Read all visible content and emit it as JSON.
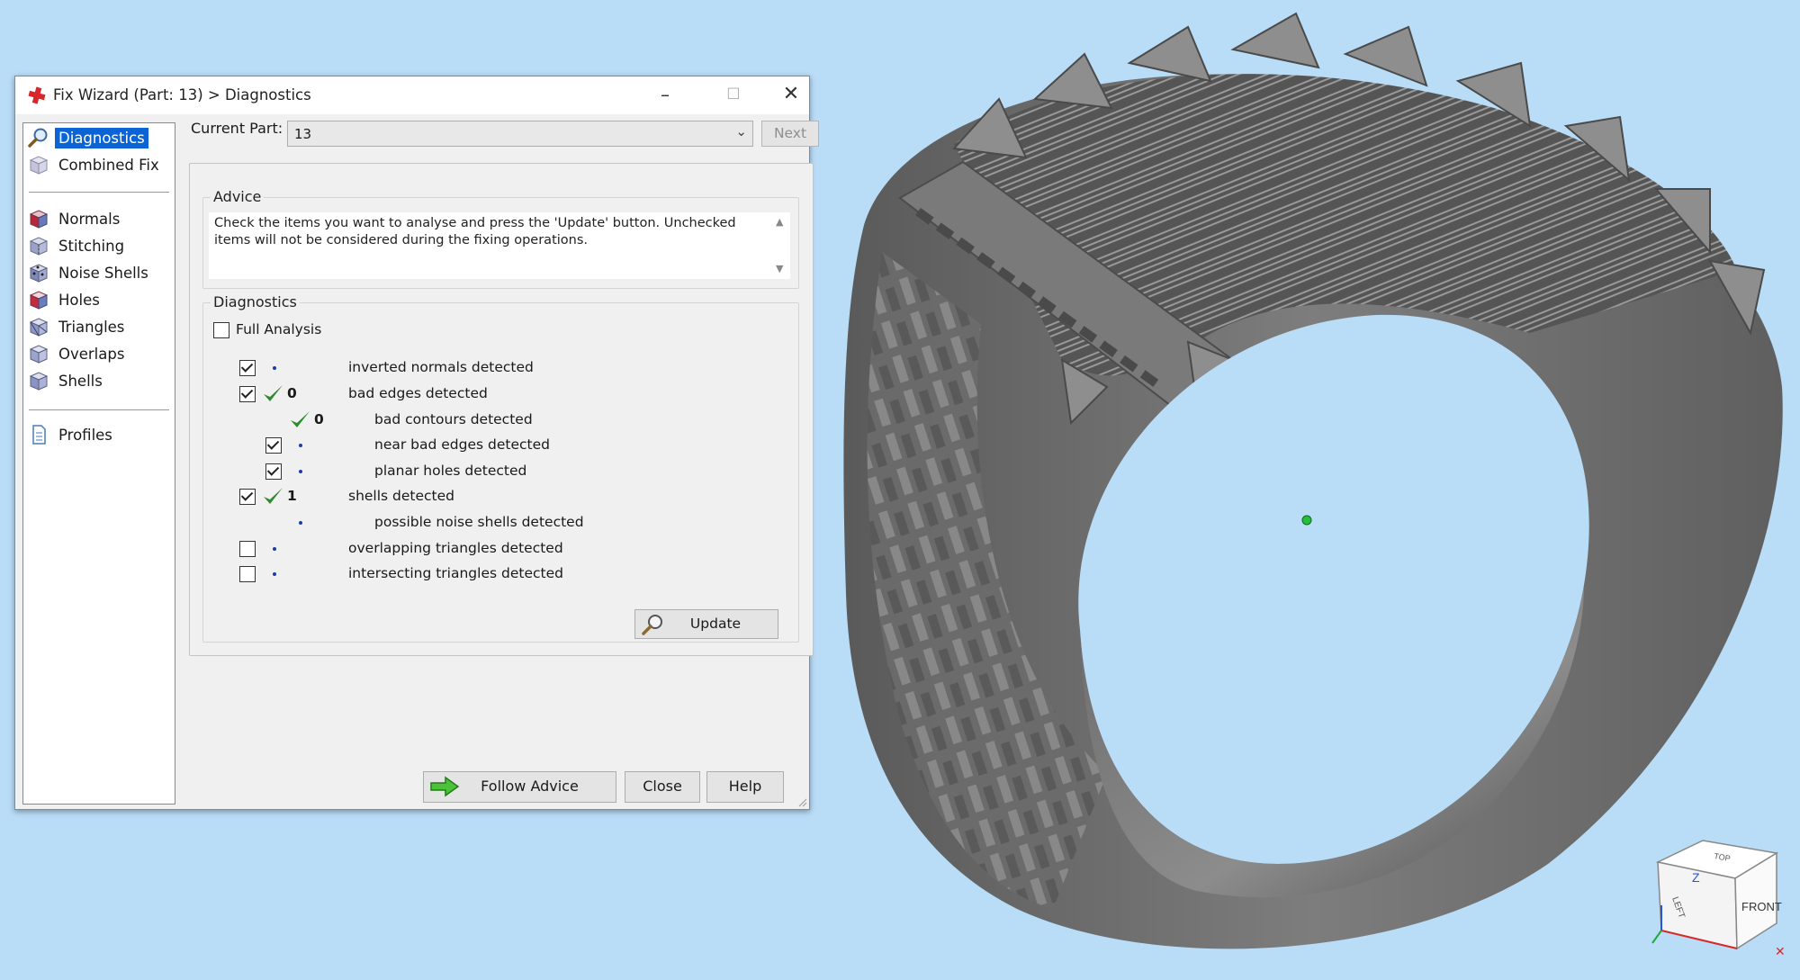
{
  "window": {
    "title": "Fix Wizard (Part: 13) > Diagnostics",
    "minimize_glyph": "–",
    "maximize_glyph": "☐",
    "close_glyph": "✕"
  },
  "nav": {
    "items": [
      {
        "label": "Diagnostics",
        "icon": "magnifier-icon",
        "selected": true
      },
      {
        "label": "Combined Fix",
        "icon": "cube-icon"
      },
      {
        "label": "Normals",
        "icon": "normals-cube-icon"
      },
      {
        "label": "Stitching",
        "icon": "stitching-cube-icon"
      },
      {
        "label": "Noise Shells",
        "icon": "noise-shells-icon"
      },
      {
        "label": "Holes",
        "icon": "holes-cube-icon"
      },
      {
        "label": "Triangles",
        "icon": "triangles-cube-icon"
      },
      {
        "label": "Overlaps",
        "icon": "overlaps-cube-icon"
      },
      {
        "label": "Shells",
        "icon": "shells-cube-icon"
      },
      {
        "label": "Profiles",
        "icon": "document-icon"
      }
    ]
  },
  "current_part": {
    "label": "Current Part:",
    "value": "13",
    "next_label": "Next"
  },
  "advice": {
    "title": "Advice",
    "text": "Check the items you want to analyse and press the 'Update' button. Unchecked items will not be considered during the fixing operations."
  },
  "diagnostics": {
    "title": "Diagnostics",
    "full_analysis_label": "Full Analysis",
    "rows": [
      {
        "label": "inverted normals detected",
        "checked": true,
        "count": ""
      },
      {
        "label": "bad edges detected",
        "checked": true,
        "count": "0"
      },
      {
        "label": "bad contours detected",
        "count": "0"
      },
      {
        "label": "near bad edges detected",
        "checked": true,
        "count": ""
      },
      {
        "label": "planar holes detected",
        "checked": true,
        "count": ""
      },
      {
        "label": "shells detected",
        "checked": true,
        "count": "1"
      },
      {
        "label": "possible noise shells detected",
        "count": ""
      },
      {
        "label": "overlapping triangles detected",
        "checked": false,
        "count": ""
      },
      {
        "label": "intersecting triangles detected",
        "checked": false,
        "count": ""
      }
    ],
    "update_label": "Update"
  },
  "buttons": {
    "follow_advice": "Follow Advice",
    "close": "Close",
    "help": "Help"
  },
  "viewcube": {
    "top": "TOP",
    "left": "LEFT",
    "front": "FRONT",
    "axis_z": "Z"
  },
  "colors": {
    "background": "#b9dcf7",
    "selection": "#0a64d6",
    "ok_check": "#2e8b2e",
    "ring": "#6f6f6f"
  }
}
